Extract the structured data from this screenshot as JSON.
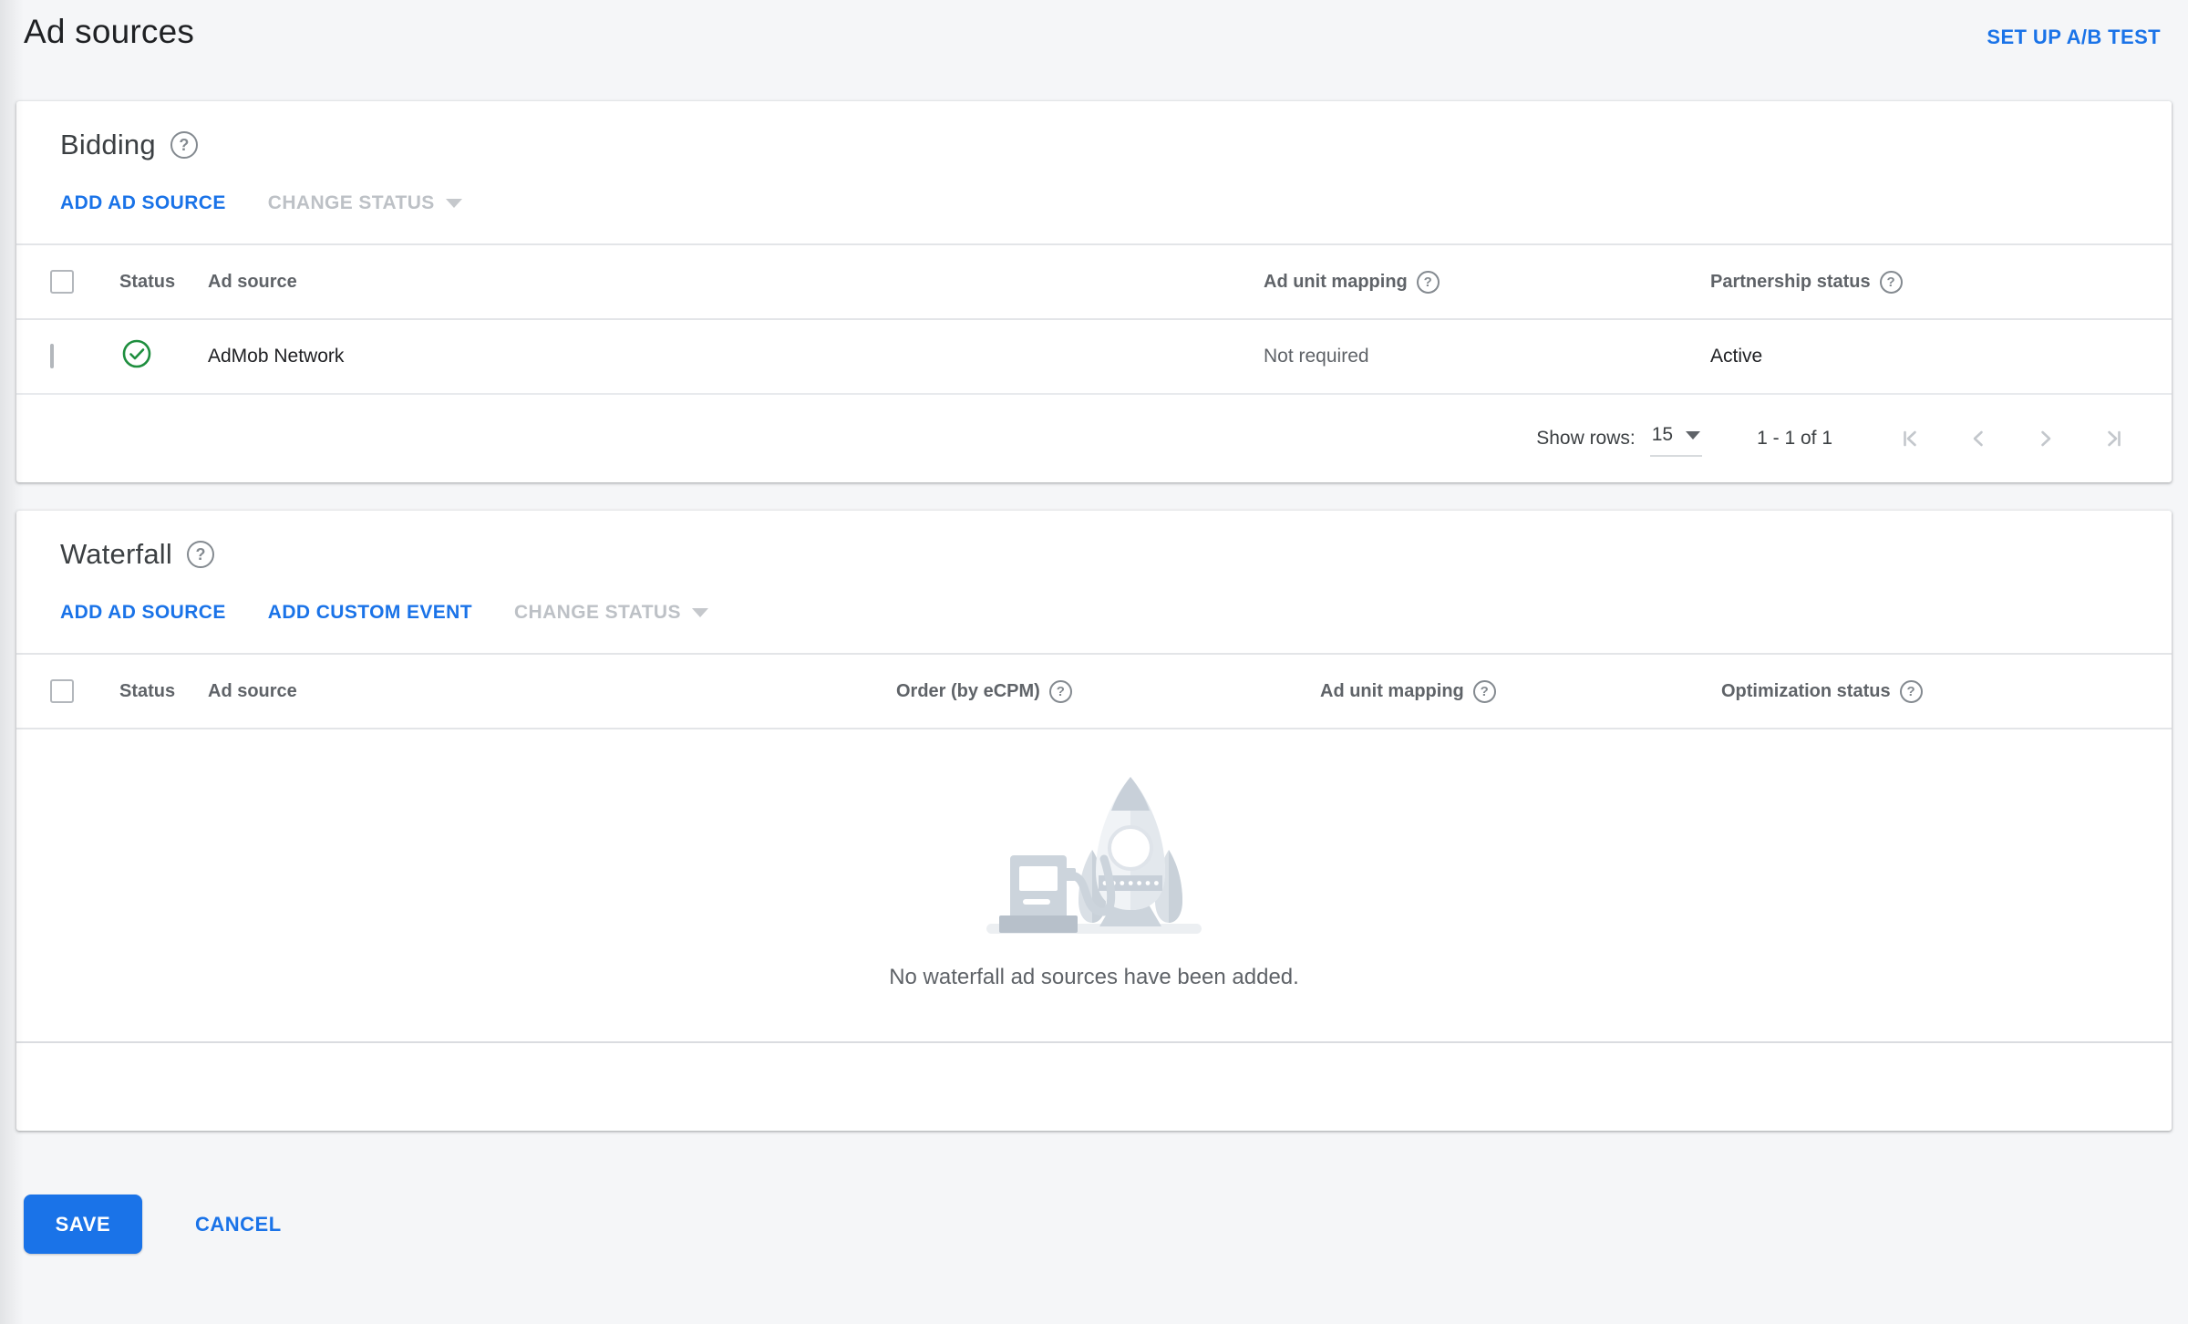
{
  "page": {
    "title": "Ad sources",
    "setup_ab_test_label": "SET UP A/B TEST"
  },
  "icons": {
    "help": "?"
  },
  "bidding": {
    "title": "Bidding",
    "actions": {
      "add_ad_source": "ADD AD SOURCE",
      "change_status": "CHANGE STATUS"
    },
    "table": {
      "columns": [
        "Status",
        "Ad source",
        "Ad unit mapping",
        "Partnership status"
      ],
      "rows": [
        {
          "status_icon": "check-circle-green",
          "ad_source": "AdMob Network",
          "ad_unit_mapping": "Not required",
          "partnership_status": "Active"
        }
      ]
    },
    "pagination": {
      "show_rows_label": "Show rows:",
      "rows_per_page": "15",
      "range": "1 - 1 of 1",
      "nav": [
        "first-page",
        "previous-page",
        "next-page",
        "last-page"
      ]
    }
  },
  "waterfall": {
    "title": "Waterfall",
    "actions": {
      "add_ad_source": "ADD AD SOURCE",
      "add_custom_event": "ADD CUSTOM EVENT",
      "change_status": "CHANGE STATUS"
    },
    "table": {
      "columns": [
        "Status",
        "Ad source",
        "Order (by eCPM)",
        "Ad unit mapping",
        "Optimization status"
      ]
    },
    "empty_state": {
      "illustration": "rocket-refueling",
      "message": "No waterfall ad sources have been added."
    }
  },
  "footer": {
    "save_label": "SAVE",
    "cancel_label": "CANCEL"
  },
  "colors": {
    "accent_blue": "#1a73e8",
    "success_green": "#1e8e3e",
    "disabled_gray": "#bdc1c6",
    "text_dark": "#202124",
    "text_muted": "#5f6368"
  }
}
